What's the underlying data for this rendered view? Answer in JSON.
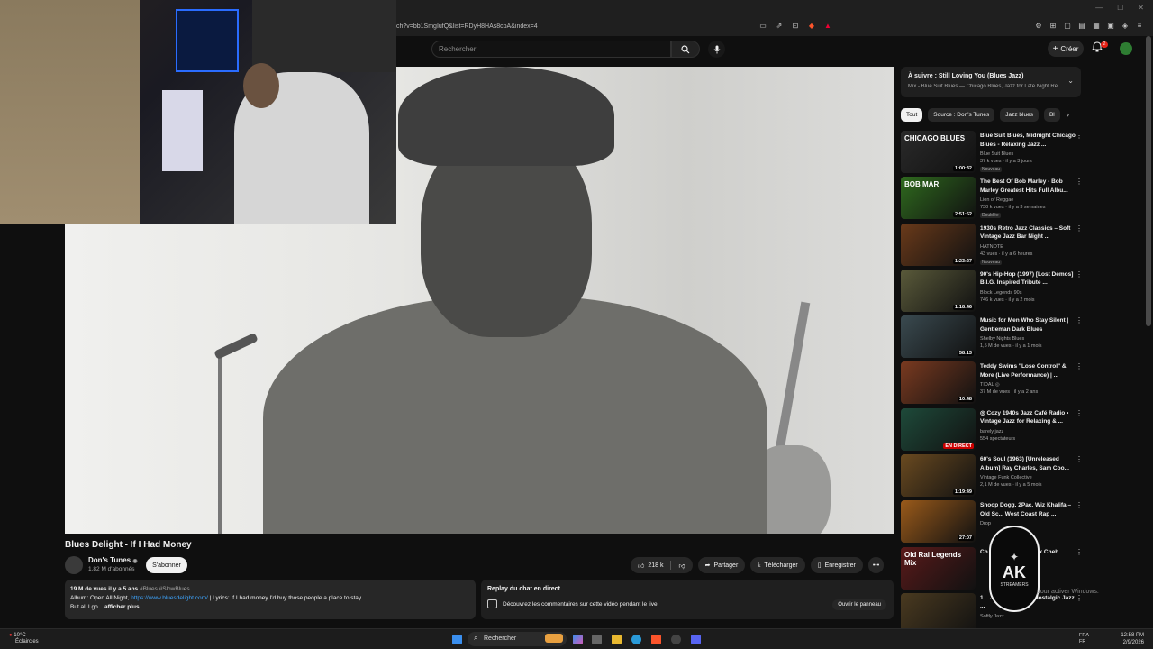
{
  "browser": {
    "url_fragment": "ch?v=bb1SmgIufQ&list=RDyH8HAs8cpA&index=4"
  },
  "header": {
    "search_placeholder": "Rechercher",
    "create_label": "Créer",
    "notif_count": "2"
  },
  "video": {
    "title": "Blues Delight - If I Had Money",
    "channel_name": "Don's Tunes",
    "subscribers": "1,82 M d'abonnés",
    "subscribe_label": "S'abonner",
    "likes": "218 k",
    "share_label": "Partager",
    "download_label": "Télécharger",
    "save_label": "Enregistrer"
  },
  "description": {
    "stats": "19 M de vues  il y a 5 ans",
    "tags": "#Blues #SlowBlues",
    "line2_prefix": "Album: Open All Night, ",
    "line2_link": "https://www.bluesdelight.com/",
    "line2_suffix": " | Lyrics:  If I had money I'd buy those people a place to stay",
    "line3_prefix": "But all I go",
    "line3_more": "...afficher plus"
  },
  "chat": {
    "title": "Replay du chat en direct",
    "text": "Découvrez les commentaires sur cette vidéo pendant le live.",
    "button": "Ouvrir le panneau"
  },
  "playlist": {
    "title": "À suivre : Still Loving You (Blues Jazz)",
    "subtitle": "Mix - Blue Suit Blues — Chicago Blues, Jazz for Late Night Re..."
  },
  "chips": [
    "Tout",
    "Source : Don's Tunes",
    "Jazz blues",
    "Bl"
  ],
  "recommendations": [
    {
      "title": "Blue Suit Blues, Midnight Chicago Blues - Relaxing Jazz ...",
      "channel": "Blue Suit Blues",
      "meta": "37 k vues · il y a 3 jours",
      "badge": "Nouveau",
      "duration": "1:00:32",
      "thumb_color": "#2a2a2a",
      "thumb_text": "CHICAGO BLUES"
    },
    {
      "title": "The Best Of Bob Marley - Bob Marley Greatest Hits Full Albu...",
      "channel": "Lion of Reggae",
      "meta": "730 k vues · il y a 3 semaines",
      "badge": "Doublée",
      "duration": "2:51:52",
      "thumb_color": "#2f6a1e",
      "thumb_text": "BOB MAR"
    },
    {
      "title": "1930s Retro Jazz Classics – Soft Vintage Jazz Bar Night ...",
      "channel": "HATNOTE",
      "meta": "43 vues · il y a 6 heures",
      "badge": "Nouveau",
      "duration": "1:23:27",
      "thumb_color": "#6a3a1a",
      "thumb_text": ""
    },
    {
      "title": "90's Hip-Hop (1997) [Lost Demos] B.I.G. Inspired Tribute ...",
      "channel": "Block Legends 90s",
      "meta": "746 k vues · il y a 2 mois",
      "badge": "",
      "duration": "1:18:46",
      "thumb_color": "#5a5a3a",
      "thumb_text": ""
    },
    {
      "title": "Music for Men Who Stay Silent | Gentleman Dark Blues",
      "channel": "Shelby Nights Blues",
      "meta": "1,5 M de vues · il y a 1 mois",
      "badge": "",
      "duration": "58:13",
      "thumb_color": "#3a4a50",
      "thumb_text": ""
    },
    {
      "title": "Teddy Swims \"Lose Control\" & More (Live Performance) | ...",
      "channel": "TIDAL ◎",
      "meta": "37 M de vues · il y a 2 ans",
      "badge": "",
      "duration": "10:48",
      "thumb_color": "#7a3a20",
      "thumb_text": ""
    },
    {
      "title": "◎ Cozy 1940s Jazz Café Radio • Vintage Jazz for Relaxing & ...",
      "channel": "barely jazz",
      "meta": "554 spectateurs",
      "badge": "",
      "duration": "EN DIRECT",
      "thumb_color": "#1e4a3a",
      "thumb_text": ""
    },
    {
      "title": "60's Soul (1963) [Unreleased Album] Ray Charles, Sam Coo...",
      "channel": "Vintage Funk Collective",
      "meta": "2,1 M de vues · il y a 5 mois",
      "badge": "",
      "duration": "1:19:49",
      "thumb_color": "#6a4a20",
      "thumb_text": ""
    },
    {
      "title": "Snoop Dogg, 2Pac, Wiz Khalifa – Old Sc... West Coast Rap ...",
      "channel": "Drop",
      "meta": "",
      "badge": "",
      "duration": "27:07",
      "thumb_color": "#9a5a1a",
      "thumb_text": ""
    },
    {
      "title": "Ch... Khaled x ... Akil x Cheb...",
      "channel": "",
      "meta": "",
      "badge": "",
      "duration": "",
      "thumb_color": "#5a1a1a",
      "thumb_text": "Old Rai Legends Mix"
    },
    {
      "title": "1... Jazz Classics – Nostalgic Jazz ...",
      "channel": "Softly Jazz",
      "meta": "",
      "badge": "",
      "duration": "",
      "thumb_color": "#4a3a20",
      "thumb_text": ""
    }
  ],
  "watermark": {
    "main": "AK",
    "sub": "STREAMERS"
  },
  "activate_text": "pour activer Windows.",
  "taskbar": {
    "weather_temp": "10°C",
    "weather_desc": "Éclaircies",
    "search_label": "Rechercher",
    "lang": "FRA",
    "lang2": "FR",
    "time": "12:58 PM",
    "date": "2/9/2026"
  }
}
